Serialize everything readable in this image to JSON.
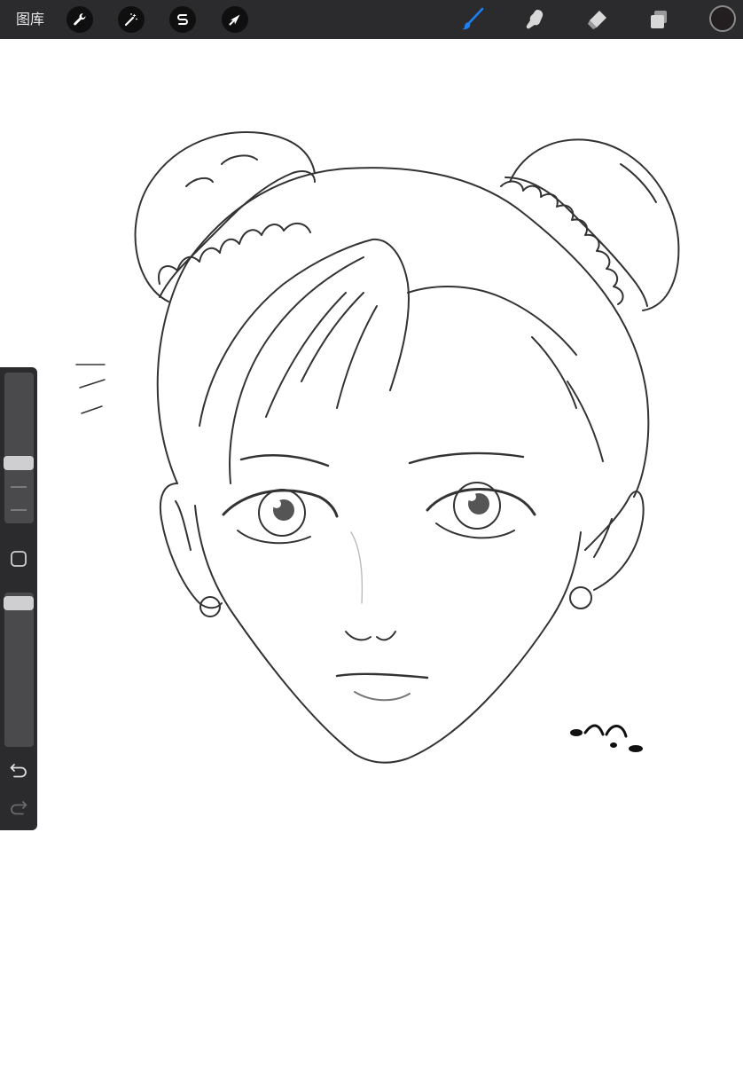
{
  "topbar": {
    "gallery_label": "图库",
    "left_tools": [
      {
        "name": "actions",
        "icon": "wrench-icon"
      },
      {
        "name": "adjustments",
        "icon": "magic-wand-icon"
      },
      {
        "name": "selection",
        "icon": "selection-s-icon"
      },
      {
        "name": "transform",
        "icon": "arrow-cursor-icon"
      }
    ],
    "right_tools": [
      {
        "name": "brush",
        "icon": "brush-icon",
        "active": true
      },
      {
        "name": "smudge",
        "icon": "smudge-finger-icon",
        "active": false
      },
      {
        "name": "eraser",
        "icon": "eraser-icon",
        "active": false
      },
      {
        "name": "layers",
        "icon": "layers-icon",
        "active": false
      }
    ],
    "current_color": "#231f20",
    "active_color": "#1e7ff0"
  },
  "sidebar": {
    "brush_size_icon": "brush-size-slider",
    "modify_icon": "square-modify-icon",
    "opacity_icon": "opacity-slider",
    "undo_icon": "undo-icon",
    "redo_icon": "redo-icon"
  },
  "canvas": {
    "background": "#ffffff",
    "subject": "line-art-sketch"
  }
}
